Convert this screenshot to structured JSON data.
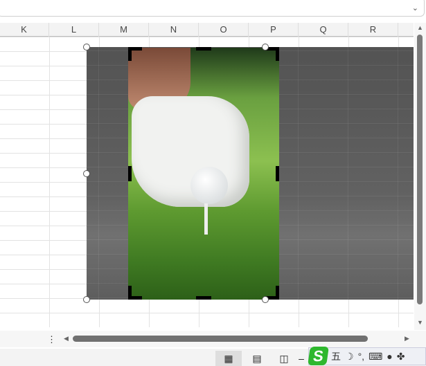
{
  "columns": [
    "K",
    "L",
    "M",
    "N",
    "O",
    "P",
    "Q",
    "R"
  ],
  "status": {
    "normal_view": "Normal view",
    "page_layout": "Page layout",
    "page_break": "Page break preview",
    "zoom_minus": "–"
  },
  "ime": {
    "logo": "S",
    "wubi": "五",
    "moon": "☽",
    "punct": "°,",
    "keyboard": "⌨",
    "user": "●",
    "grid": "✤"
  },
  "icons": {
    "expand": "⌄",
    "more": "⋮",
    "left": "◀",
    "right": "▶",
    "up": "▲",
    "down": "▼"
  }
}
